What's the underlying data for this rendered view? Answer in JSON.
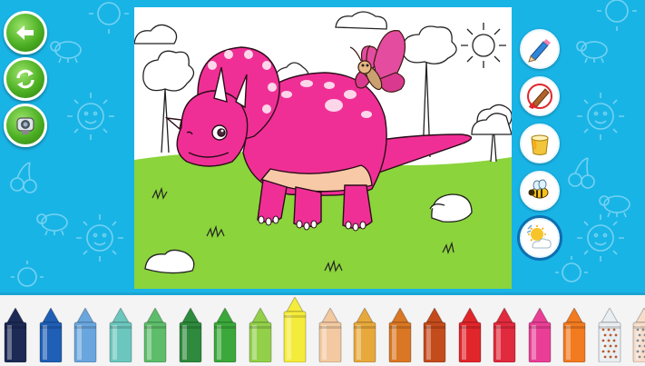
{
  "colors": {
    "background": "#19b4e6",
    "dino": "#f02f96",
    "belly": "#f8c9a7",
    "grass": "#8bd43c",
    "butterfly_wing": "#e44ca0"
  },
  "left_buttons": [
    {
      "name": "back-button",
      "icon": "arrow-left-icon"
    },
    {
      "name": "refresh-button",
      "icon": "refresh-icon"
    },
    {
      "name": "camera-button",
      "icon": "camera-icon"
    }
  ],
  "tools": [
    {
      "name": "pencil-tool",
      "icon": "pencil-icon"
    },
    {
      "name": "brush-tool",
      "icon": "brush-icon"
    },
    {
      "name": "bucket-tool",
      "icon": "paint-bucket-icon"
    },
    {
      "name": "stamp-tool",
      "icon": "bee-icon"
    },
    {
      "name": "scene-tool",
      "icon": "sun-cloud-icon",
      "selected": true
    }
  ],
  "crayons": [
    {
      "color": "#1c2a55"
    },
    {
      "color": "#1f5fb5"
    },
    {
      "color": "#6aa6de"
    },
    {
      "color": "#6bc7bd"
    },
    {
      "color": "#5dbd6a"
    },
    {
      "color": "#2e8a3d"
    },
    {
      "color": "#3aa83a"
    },
    {
      "color": "#93d04a"
    },
    {
      "color": "#f4ec3a",
      "selected": true
    },
    {
      "color": "#f3c9a1"
    },
    {
      "color": "#e8a93c"
    },
    {
      "color": "#d97724"
    },
    {
      "color": "#c44b1c"
    },
    {
      "color": "#e0262b"
    },
    {
      "color": "#e12a3d"
    },
    {
      "color": "#ea3e96"
    },
    {
      "color": "#f27a1f"
    },
    {
      "color": "#e9eef2",
      "pattern": "dots"
    },
    {
      "color": "#f7dcc8",
      "pattern": "dots"
    }
  ]
}
